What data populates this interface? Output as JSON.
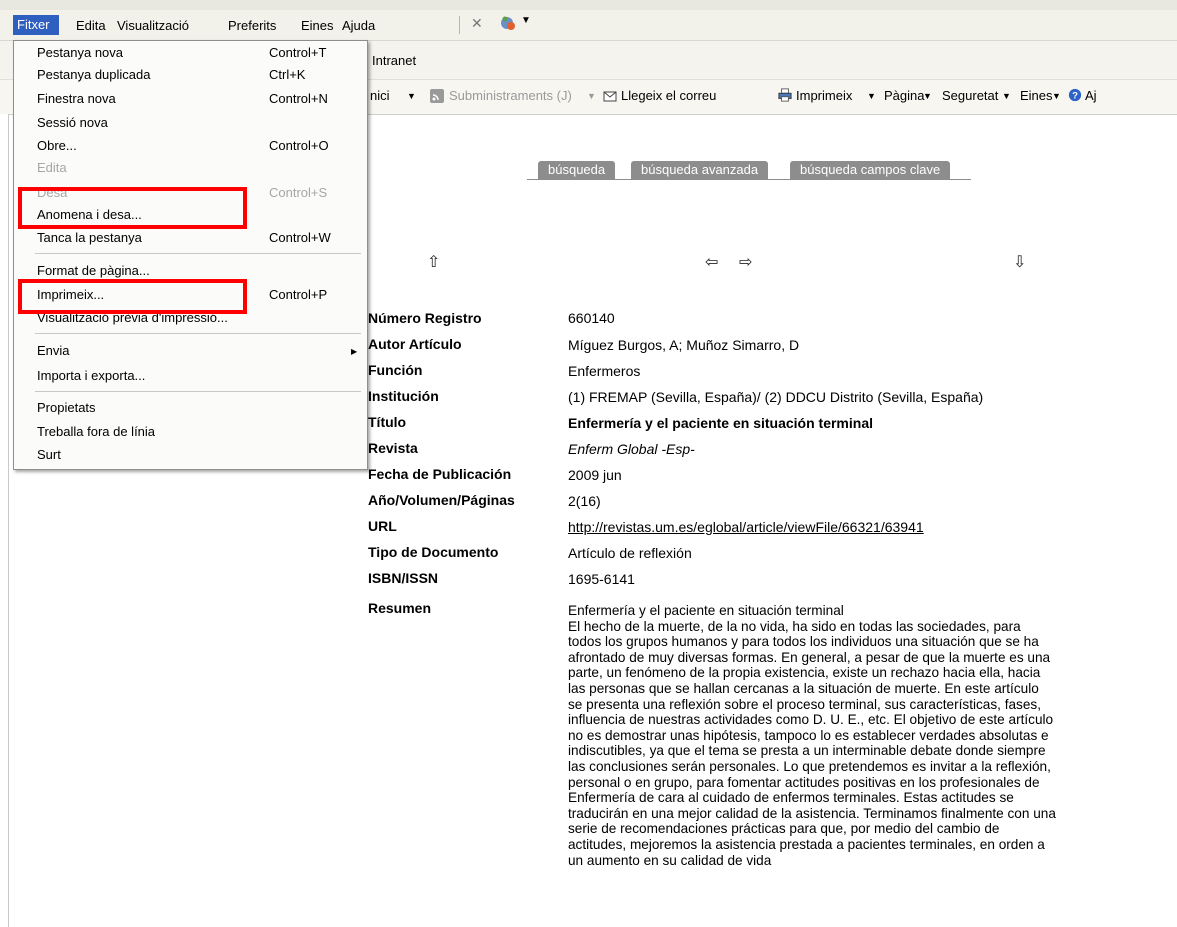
{
  "menubar": {
    "items": [
      "Fitxer",
      "Edita",
      "Visualització",
      "Preferits",
      "Eines",
      "Ajuda"
    ]
  },
  "tab": {
    "title": "Intranet"
  },
  "commandbar": {
    "inici": "nici",
    "feeds": "Subministraments (J)",
    "mail": "Llegeix el correu",
    "print": "Imprimeix",
    "page": "Pàgina",
    "security": "Seguretat",
    "tools": "Eines",
    "help": "Aj"
  },
  "file_menu": {
    "items": [
      {
        "label": "Pestanya nova",
        "shortcut": "Control+T",
        "enabled": true
      },
      {
        "label": "Pestanya duplicada",
        "shortcut": "Ctrl+K",
        "enabled": true
      },
      {
        "label": "Finestra nova",
        "shortcut": "Control+N",
        "enabled": true
      },
      {
        "label": "Sessió nova",
        "shortcut": "",
        "enabled": true
      },
      {
        "label": "Obre...",
        "shortcut": "Control+O",
        "enabled": true
      },
      {
        "label": "Edita",
        "shortcut": "",
        "enabled": false
      },
      {
        "label": "Desa",
        "shortcut": "Control+S",
        "enabled": false
      },
      {
        "label": "Anomena i desa...",
        "shortcut": "",
        "enabled": true
      },
      {
        "label": "Tanca la pestanya",
        "shortcut": "Control+W",
        "enabled": true
      },
      {
        "label": "Format de pàgina...",
        "shortcut": "",
        "enabled": true
      },
      {
        "label": "Imprimeix...",
        "shortcut": "Control+P",
        "enabled": true
      },
      {
        "label": "Visualització prèvia d'impressió...",
        "shortcut": "",
        "enabled": true
      },
      {
        "label": "Envia",
        "shortcut": "",
        "enabled": true
      },
      {
        "label": "Importa i exporta...",
        "shortcut": "",
        "enabled": true
      },
      {
        "label": "Propietats",
        "shortcut": "",
        "enabled": true
      },
      {
        "label": "Treballa fora de línia",
        "shortcut": "",
        "enabled": true
      },
      {
        "label": "Surt",
        "shortcut": "",
        "enabled": true
      }
    ]
  },
  "search_tabs": [
    "búsqueda",
    "búsqueda avanzada",
    "búsqueda campos clave"
  ],
  "record": {
    "labels": {
      "numero": "Número Registro",
      "autor": "Autor Artículo",
      "funcion": "Función",
      "institucion": "Institución",
      "titulo": "Título",
      "revista": "Revista",
      "fecha": "Fecha de Publicación",
      "anio": "Año/Volumen/Páginas",
      "url": "URL",
      "tipo": "Tipo de Documento",
      "isbn": "ISBN/ISSN",
      "resumen": "Resumen"
    },
    "values": {
      "numero": "660140",
      "autor": "Míguez Burgos, A; Muñoz Simarro, D",
      "funcion": "Enfermeros",
      "institucion": "(1) FREMAP (Sevilla, España)/ (2) DDCU Distrito (Sevilla, España)",
      "titulo": "Enfermería y el paciente en situación terminal",
      "revista": "Enferm Global -Esp-",
      "fecha": "2009 jun",
      "anio": "2(16)",
      "url": "http://revistas.um.es/eglobal/article/viewFile/66321/63941",
      "tipo": "Artículo de reflexión",
      "isbn": "1695-6141",
      "resumen_lines": [
        "Enfermería y el paciente en situación terminal",
        "El hecho de la muerte, de la no vida, ha sido en todas las sociedades, para",
        "todos los grupos humanos y para todos los individuos una situación que se ha",
        "afrontado de muy diversas formas. En general, a pesar de que la muerte es una",
        "parte, un fenómeno de la propia existencia, existe un rechazo hacia ella, hacia",
        "las personas que se hallan cercanas a la situación de muerte. En este artículo",
        "se presenta una reflexión sobre el proceso terminal, sus características, fases,",
        "influencia de nuestras actividades como D. U. E., etc. El objetivo de este artículo",
        "no es demostrar unas hipótesis, tampoco lo es establecer verdades absolutas e",
        "indiscutibles, ya que el tema se presta a un interminable debate donde siempre",
        "las conclusiones serán personales. Lo que pretendemos es invitar a la reflexión,",
        "personal o en grupo, para fomentar actitudes positivas en los profesionales de",
        "Enfermería de cara al cuidado de enfermos terminales. Estas actitudes se",
        "traducirán en una mejor calidad de la asistencia. Terminamos finalmente con una",
        "serie de recomendaciones prácticas para que, por medio del cambio de",
        "actitudes, mejoremos la asistencia prestada a pacientes terminales, en orden a",
        "un aumento en su calidad de vida"
      ]
    }
  },
  "colors": {
    "highlight_box": "#ff0000",
    "menu_selected": "#2f5fbf",
    "tab_gray": "#8d8d8d"
  }
}
